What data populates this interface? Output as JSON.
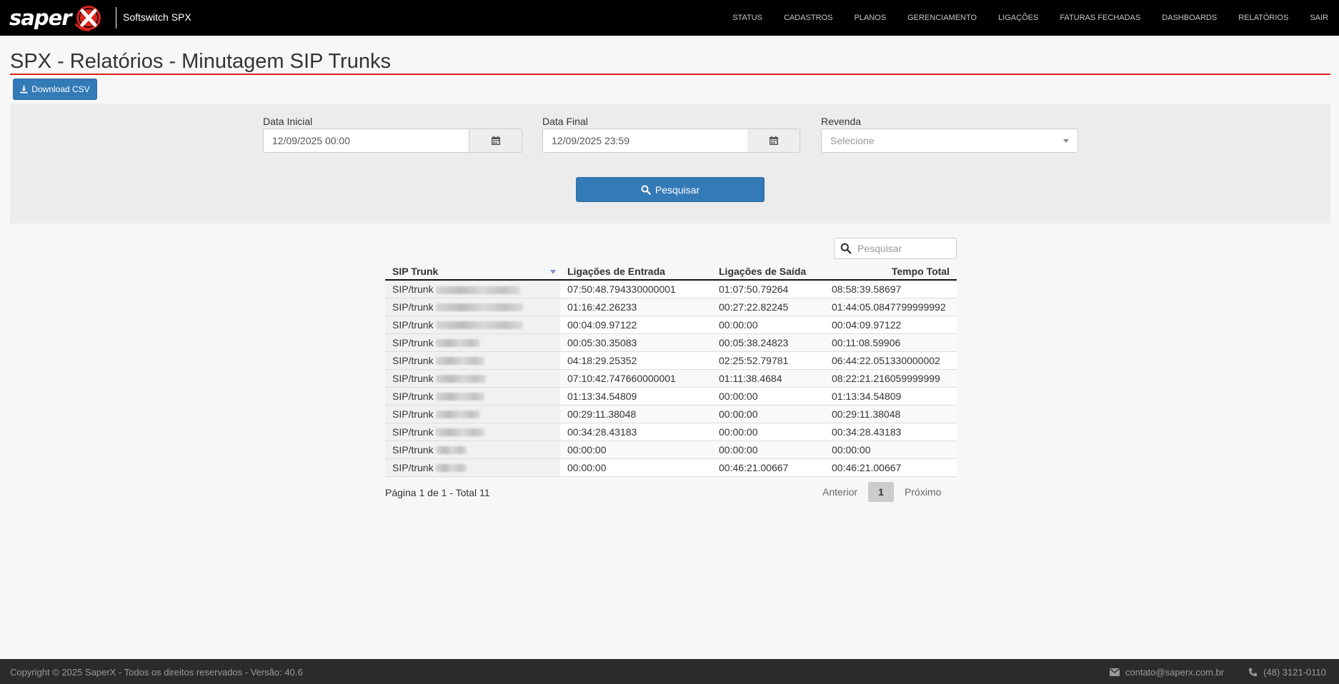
{
  "navbar": {
    "logo_text": "saper",
    "brand": "Softswitch SPX",
    "items": [
      "STATUS",
      "CADASTROS",
      "PLANOS",
      "GERENCIAMENTO",
      "LIGAÇÕES",
      "FATURAS FECHADAS",
      "DASHBOARDS",
      "RELATÓRIOS",
      "SAIR"
    ]
  },
  "page": {
    "title": "SPX - Relatórios - Minutagem SIP Trunks",
    "download_label": "Download CSV"
  },
  "filters": {
    "start_label": "Data Inicial",
    "start_value": "12/09/2025 00:00",
    "end_label": "Data Final",
    "end_value": "12/09/2025 23:59",
    "reseller_label": "Revenda",
    "reseller_placeholder": "Selecione",
    "search_button": "Pesquisar"
  },
  "table": {
    "search_placeholder": "Pesquisar",
    "columns": [
      "SIP Trunk",
      "Ligações de Entrada",
      "Ligações de Saída",
      "Tempo Total"
    ],
    "rows": [
      {
        "trunk": "SIP/trunk",
        "in": "07:50:48.794330000001",
        "out": "01:07:50.79264",
        "total": "08:58:39.58697"
      },
      {
        "trunk": "SIP/trunk",
        "in": "01:16:42.26233",
        "out": "00:27:22.82245",
        "total": "01:44:05.0847799999992"
      },
      {
        "trunk": "SIP/trunk",
        "in": "00:04:09.97122",
        "out": "00:00:00",
        "total": "00:04:09.97122"
      },
      {
        "trunk": "SIP/trunk",
        "in": "00:05:30.35083",
        "out": "00:05:38.24823",
        "total": "00:11:08.59906"
      },
      {
        "trunk": "SIP/trunk",
        "in": "04:18:29.25352",
        "out": "02:25:52.79781",
        "total": "06:44:22.051330000002"
      },
      {
        "trunk": "SIP/trunk",
        "in": "07:10:42.747660000001",
        "out": "01:11:38.4684",
        "total": "08:22:21.216059999999"
      },
      {
        "trunk": "SIP/trunk",
        "in": "01:13:34.54809",
        "out": "00:00:00",
        "total": "01:13:34.54809"
      },
      {
        "trunk": "SIP/trunk",
        "in": "00:29:11.38048",
        "out": "00:00:00",
        "total": "00:29:11.38048"
      },
      {
        "trunk": "SIP/trunk",
        "in": "00:34:28.43183",
        "out": "00:00:00",
        "total": "00:34:28.43183"
      },
      {
        "trunk": "SIP/trunk",
        "in": "00:00:00",
        "out": "00:00:00",
        "total": "00:00:00"
      },
      {
        "trunk": "SIP/trunk",
        "in": "00:00:00",
        "out": "00:46:21.00667",
        "total": "00:46:21.00667"
      }
    ],
    "page_info": "Página 1 de 1 - Total 11",
    "prev_label": "Anterior",
    "current_page": "1",
    "next_label": "Próximo"
  },
  "footer": {
    "copyright": "Copyright © 2025 SaperX - Todos os direitos reservados - Versão: 40.6",
    "email": "contato@saperx.com.br",
    "phone": "(48) 3121-0110"
  },
  "colors": {
    "accent": "#337ab7",
    "title_rule": "#d9251d",
    "logo_red": "#d9251d"
  }
}
